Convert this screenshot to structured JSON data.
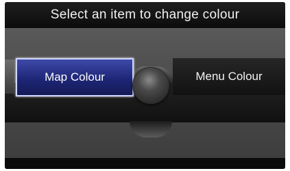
{
  "header": {
    "title": "Select an item to change colour"
  },
  "options": {
    "map_colour": "Map Colour",
    "menu_colour": "Menu Colour"
  },
  "colors": {
    "selected_accent": "#1e2677",
    "background": "#4b4b4b"
  },
  "icons": {
    "selector": "joystick-knob-icon"
  }
}
